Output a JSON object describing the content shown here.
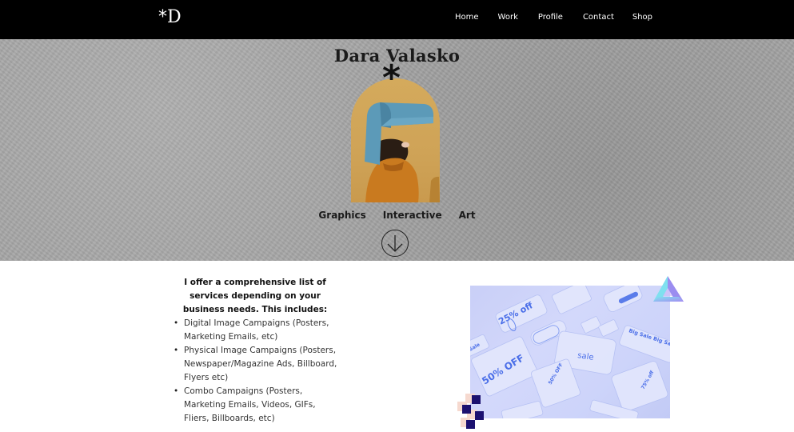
{
  "header": {
    "logo": {
      "star": "*",
      "letter": "D"
    },
    "nav": [
      {
        "label": "Home"
      },
      {
        "label": "Work"
      },
      {
        "label": "Profile"
      },
      {
        "label": "Contact"
      },
      {
        "label": "Shop"
      }
    ]
  },
  "hero": {
    "title": "Dara Valasko",
    "asterisk": "*",
    "categories": [
      {
        "label": "Graphics"
      },
      {
        "label": "Interactive"
      },
      {
        "label": "Art"
      }
    ],
    "scroll_icon": "arrow-down-circle-icon"
  },
  "services": {
    "intro": "I offer a comprehensive list of services depending on your business needs. This includes:",
    "items": [
      "Digital Image Campaigns (Posters, Marketing Emails, etc)",
      "Physical Image Campaigns (Posters, Newspaper/Magazine Ads, Billboard, Flyers etc)",
      "Combo Campaigns (Posters, Marketing Emails, Videos, GIFs, Fliers, Billboards, etc)"
    ]
  },
  "promo_image": {
    "labels": [
      "25% off",
      "sale",
      "50% OFF",
      "50% OFF",
      "Big Sale Big Sale",
      "75% off",
      "Sale"
    ]
  },
  "colors": {
    "header_bg": "#000000",
    "hero_bg": "#a4a4a4",
    "arch_bg": "#d4aa5c",
    "promo_tint": "#cdd4fa",
    "promo_text": "#4a6ee8",
    "block_dark": "#1c1170",
    "block_light": "#f6d9cf"
  }
}
